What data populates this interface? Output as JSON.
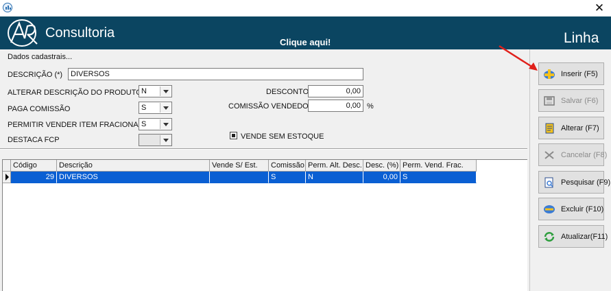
{
  "window": {
    "close_glyph": "✕"
  },
  "header": {
    "brand": "Consultoria",
    "cta": "Clique aqui!",
    "module": "Linha",
    "logo_text": "AR"
  },
  "form": {
    "section_title": "Dados cadastrais...",
    "descricao": {
      "label": "DESCRIÇÃO (*)",
      "value": "DIVERSOS"
    },
    "alterar_descricao": {
      "label": "ALTERAR DESCRIÇÃO DO PRODUTO",
      "value": "N"
    },
    "paga_comissao": {
      "label": "PAGA COMISSÃO",
      "value": "S"
    },
    "permitir_fracionado": {
      "label": "PERMITIR VENDER ITEM FRACIONADO",
      "value": "S"
    },
    "destaca_fcp": {
      "label": "DESTACA FCP",
      "value": ""
    },
    "desconto": {
      "label": "DESCONTO",
      "value": "0,00"
    },
    "comissao_vendedor": {
      "label": "COMISSÃO VENDEDOR",
      "value": "0,00",
      "unit": "%"
    },
    "vende_sem_estoque": {
      "label": "VENDE SEM ESTOQUE",
      "checked": true
    }
  },
  "grid": {
    "columns": [
      "Código",
      "Descrição",
      "Vende S/ Est.",
      "Comissão",
      "Perm. Alt. Desc.",
      "Desc. (%)",
      "Perm. Vend. Frac."
    ],
    "rows": [
      {
        "codigo": "29",
        "descricao": "DIVERSOS",
        "vende_sem_est": "",
        "comissao": "S",
        "perm_alt_desc": "N",
        "desc": "0,00",
        "perm_vend_frac": "S",
        "selected": true
      }
    ]
  },
  "toolbar": {
    "inserir": "Inserir (F5)",
    "salvar": "Salvar (F6)",
    "alterar": "Alterar (F7)",
    "cancelar": "Cancelar (F8)",
    "pesquisar": "Pesquisar (F9)",
    "excluir": "Excluir (F10)",
    "atualizar": "Atualizar(F11)"
  },
  "colors": {
    "header_bg": "#0b4561",
    "selection": "#0a5fd3",
    "annotation_arrow": "#e0201b"
  }
}
